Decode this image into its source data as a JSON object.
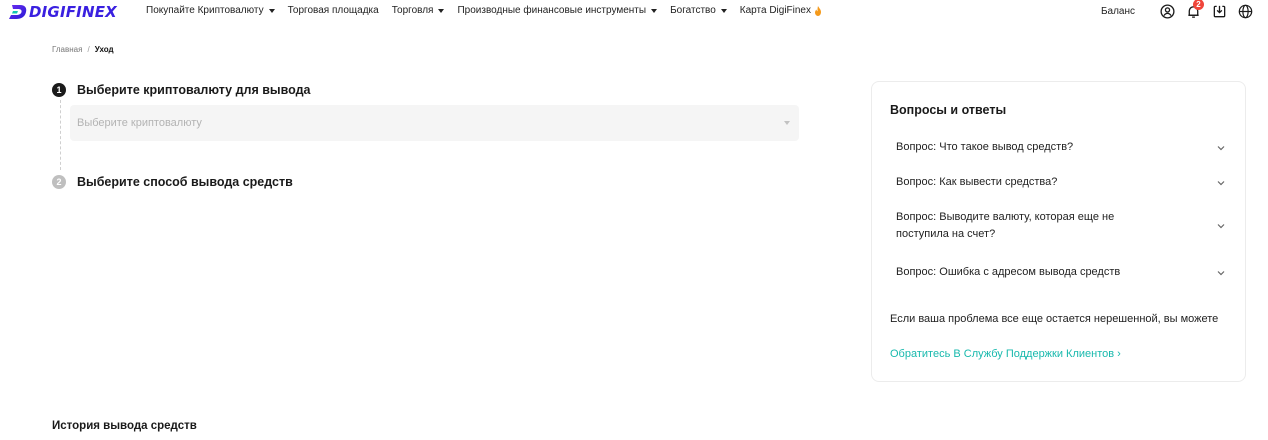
{
  "brand": {
    "name": "DIGIFINEX",
    "color": "#3a20e0"
  },
  "nav": {
    "items": [
      {
        "label": "Покупайте Криптовалюту",
        "dropdown": true
      },
      {
        "label": "Торговая площадка",
        "dropdown": false
      },
      {
        "label": "Торговля",
        "dropdown": true
      },
      {
        "label": "Производные финансовые инструменты",
        "dropdown": true
      },
      {
        "label": "Богатство",
        "dropdown": true
      },
      {
        "label": "Карта DigiFinex",
        "dropdown": false,
        "icon": "fire-icon"
      }
    ],
    "balance_label": "Баланс",
    "notification_count": "2",
    "icons": [
      "user-icon",
      "bell-icon",
      "download-icon",
      "globe-icon"
    ]
  },
  "breadcrumb": {
    "home": "Главная",
    "separator": "/",
    "current": "Уход"
  },
  "steps": {
    "step1": {
      "number": "1",
      "title": "Выберите криптовалюту для вывода",
      "select_placeholder": "Выберите криптовалюту"
    },
    "step2": {
      "number": "2",
      "title": "Выберите способ вывода средств"
    }
  },
  "faq": {
    "title": "Вопросы и ответы",
    "items": [
      {
        "question": "Вопрос: Что такое вывод средств?"
      },
      {
        "question": "Вопрос: Как вывести средства?"
      },
      {
        "question": "Вопрос: Выводите валюту, которая еще не поступила на счет?"
      },
      {
        "question": "Вопрос: Ошибка с адресом вывода средств"
      }
    ],
    "note": "Если ваша проблема все еще остается нерешенной, вы можете",
    "support_link": "Обратитесь В Службу Поддержки Клиентов ›",
    "link_color": "#18b9ad"
  },
  "history": {
    "title": "История вывода средств"
  }
}
